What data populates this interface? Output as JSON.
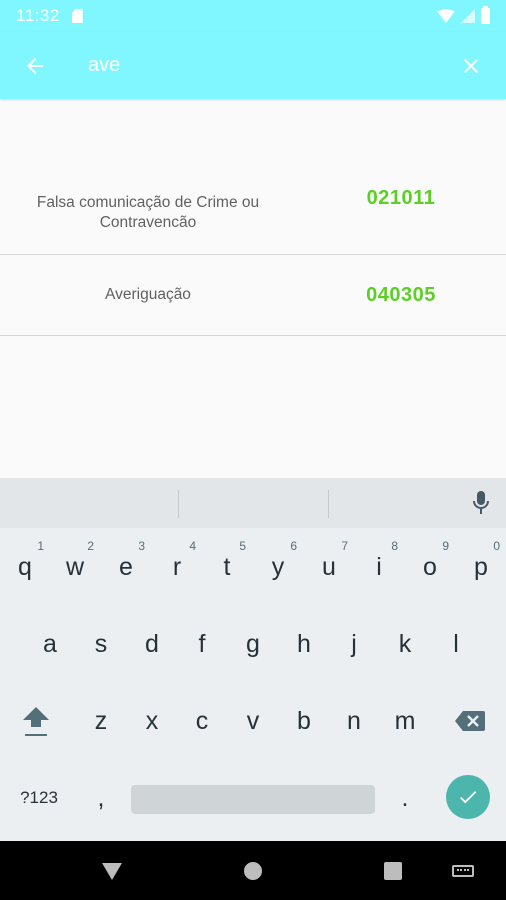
{
  "status_bar": {
    "time": "11:32"
  },
  "app_bar": {
    "search_value": "ave"
  },
  "results": [
    {
      "description": "Falsa comunicação de Crime ou Contravencão",
      "code": "021011"
    },
    {
      "description": "Averiguação",
      "code": "040305"
    }
  ],
  "keyboard": {
    "row1": [
      {
        "key": "q",
        "hint": "1"
      },
      {
        "key": "w",
        "hint": "2"
      },
      {
        "key": "e",
        "hint": "3"
      },
      {
        "key": "r",
        "hint": "4"
      },
      {
        "key": "t",
        "hint": "5"
      },
      {
        "key": "y",
        "hint": "6"
      },
      {
        "key": "u",
        "hint": "7"
      },
      {
        "key": "i",
        "hint": "8"
      },
      {
        "key": "o",
        "hint": "9"
      },
      {
        "key": "p",
        "hint": "0"
      }
    ],
    "row2": [
      "a",
      "s",
      "d",
      "f",
      "g",
      "h",
      "j",
      "k",
      "l"
    ],
    "row3": [
      "z",
      "x",
      "c",
      "v",
      "b",
      "n",
      "m"
    ],
    "symbols_label": "?123",
    "comma": ",",
    "period": "."
  },
  "colors": {
    "app_bar": "#80f6ff",
    "code_green": "#5ccf26",
    "enter_teal": "#4db6ac"
  }
}
